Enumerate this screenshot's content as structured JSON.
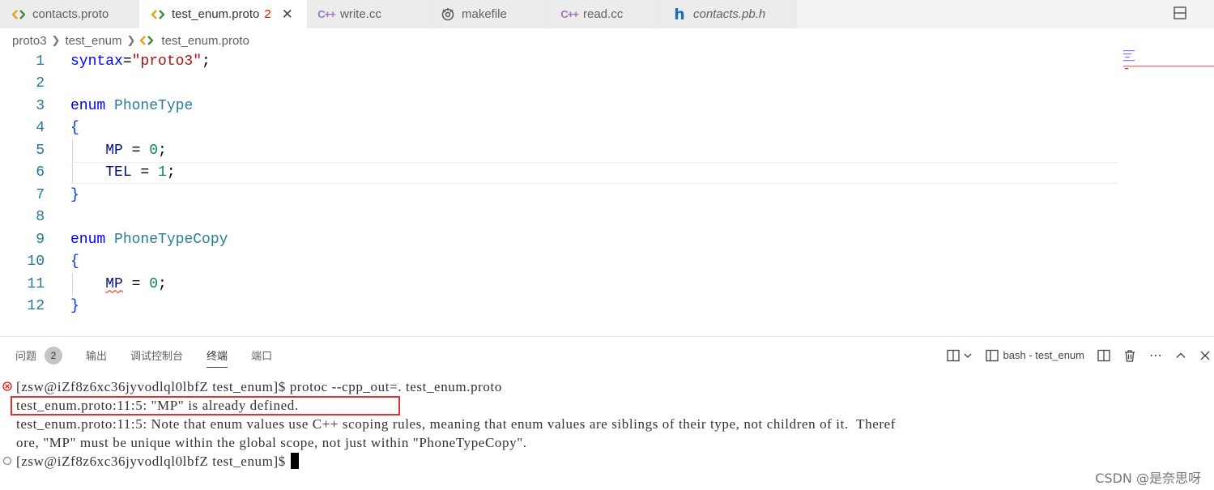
{
  "tabs": [
    {
      "label": "contacts.proto",
      "icon": "proto-icon"
    },
    {
      "label": "test_enum.proto",
      "icon": "proto-icon",
      "badge": "2",
      "close": "✕"
    },
    {
      "label": "write.cc",
      "icon": "cpp-icon"
    },
    {
      "label": "makefile",
      "icon": "makefile-icon"
    },
    {
      "label": "read.cc",
      "icon": "cpp-icon"
    },
    {
      "label": "contacts.pb.h",
      "icon": "header-icon"
    }
  ],
  "breadcrumb": [
    "proto3",
    "test_enum",
    "test_enum.proto"
  ],
  "editor": {
    "line_numbers": [
      "1",
      "2",
      "3",
      "4",
      "5",
      "6",
      "7",
      "8",
      "9",
      "10",
      "11",
      "12"
    ],
    "code": {
      "l1_kw": "syntax",
      "l1_eq": "=",
      "l1_str": "\"proto3\"",
      "l1_semi": ";",
      "l3_kw": "enum",
      "l3_type": "PhoneType",
      "l4": "{",
      "l5_id": "MP",
      "l5_eq": " = ",
      "l5_num": "0",
      "l5_semi": ";",
      "l6_id": "TEL",
      "l6_eq": " = ",
      "l6_num": "1",
      "l6_semi": ";",
      "l7": "}",
      "l9_kw": "enum",
      "l9_type": "PhoneTypeCopy",
      "l10": "{",
      "l11_id": "MP",
      "l11_eq": " = ",
      "l11_num": "0",
      "l11_semi": ";",
      "l12": "}"
    }
  },
  "panel": {
    "tabs": [
      "问题",
      "输出",
      "调试控制台",
      "终端",
      "端口"
    ],
    "problems_count": "2",
    "active_tab": "终端",
    "terminal_name": "bash - test_enum"
  },
  "terminal": {
    "lines": [
      "[zsw@iZf8z6xc36jyvodlql0lbfZ test_enum]$ protoc --cpp_out=. test_enum.proto",
      "test_enum.proto:11:5: \"MP\" is already defined.",
      "test_enum.proto:11:5: Note that enum values use C++ scoping rules, meaning that enum values are siblings of their type, not children of it.  Theref",
      "ore, \"MP\" must be unique within the global scope, not just within \"PhoneTypeCopy\".",
      "[zsw@iZf8z6xc36jyvodlql0lbfZ test_enum]$"
    ]
  },
  "watermark": "CSDN @是奈思呀",
  "colors": {
    "keyword": "#0000ff",
    "type": "#267f99",
    "string": "#a31515",
    "number": "#098658",
    "error": "#e51400",
    "highlight_box": "#e03030"
  }
}
